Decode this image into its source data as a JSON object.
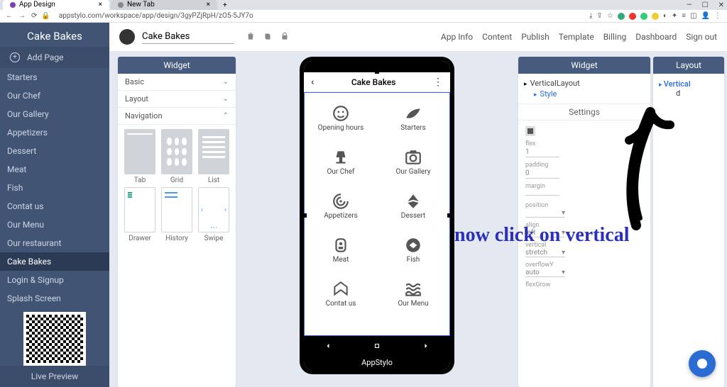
{
  "browser": {
    "tabs": [
      {
        "title": "App Design",
        "favicon": "#7b3fb5"
      },
      {
        "title": "New Tab",
        "favicon": "#888"
      }
    ],
    "url": "appstylo.com/workspace/app/design/3gyPZjRpH/zO5-5JY7o"
  },
  "sidebar": {
    "title": "Cake Bakes",
    "add_page": "Add Page",
    "pages": [
      "Starters",
      "Our Chef",
      "Our Gallery",
      "Appetizers",
      "Dessert",
      "Meat",
      "Fish",
      "Contat us",
      "Our Menu",
      "Our restaurant",
      "Cake Bakes",
      "Login & Signup",
      "Splash Screen"
    ],
    "active_page_index": 10,
    "live_preview": "Live Preview"
  },
  "topbar": {
    "app_name": "Cake Bakes",
    "menu": [
      "App Info",
      "Content",
      "Publish",
      "Template",
      "Billing",
      "Dashboard",
      "Sign out"
    ]
  },
  "widget_panel": {
    "header": "Widget",
    "sections": {
      "basic": "Basic",
      "layout": "Layout",
      "navigation": "Navigation"
    },
    "items": [
      "Tab",
      "Grid",
      "List",
      "Drawer",
      "History",
      "Swipe"
    ]
  },
  "phone": {
    "title": "Cake Bakes",
    "items": [
      "Opening hours",
      "Starters",
      "Our Chef",
      "Our Gallery",
      "Appetizers",
      "Dessert",
      "Meat",
      "Fish",
      "Contat us",
      "Our Menu"
    ],
    "brand": "AppStylo"
  },
  "widget_tree": {
    "header": "Widget",
    "root": "VerticalLayout",
    "child": "Style",
    "settings_label": "Settings",
    "fields": {
      "flex": {
        "label": "flex",
        "value": "1"
      },
      "padding": {
        "label": "padding",
        "value": "0"
      },
      "margin": {
        "label": "margin",
        "value": ""
      },
      "position": {
        "label": "position",
        "value": ""
      },
      "align": {
        "label": "align",
        "value": "left"
      },
      "vertical": {
        "label": "vertical",
        "value": "stretch"
      },
      "overflowY": {
        "label": "overflowY",
        "value": "auto"
      },
      "flexGrow": {
        "label": "flexGrow",
        "value": ""
      }
    }
  },
  "layout_panel": {
    "header": "Layout",
    "vertical": "Vertical",
    "hidden_letter": "d"
  },
  "annotation": "now click on vertical"
}
